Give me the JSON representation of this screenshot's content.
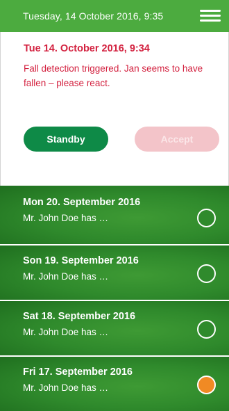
{
  "header": {
    "datetime": "Tuesday, 14 October 2016, 9:35",
    "menu_icon": "hamburger-menu-icon"
  },
  "alert": {
    "title": "Tue 14. October 2016, 9:34",
    "message": "Fall detection triggered. Jan seems to have fallen – please react.",
    "standby_label": "Standby",
    "accept_label": "Accept",
    "colors": {
      "text": "#d3213f",
      "standby": "#0e8a47",
      "accept": "#f3c4c9"
    }
  },
  "entries": [
    {
      "date": "Mon 20. September 2016",
      "text": "Mr. John Doe has …",
      "status_color": "#2f8a2c"
    },
    {
      "date": "Son 19. September 2016",
      "text": "Mr. John Doe has …",
      "status_color": "#2f8a2c"
    },
    {
      "date": "Sat 18. September 2016",
      "text": "Mr. John Doe has …",
      "status_color": "#2f8a2c"
    },
    {
      "date": "Fri 17. September 2016",
      "text": "Mr. John Doe has …",
      "status_color": "#f08a24"
    }
  ]
}
